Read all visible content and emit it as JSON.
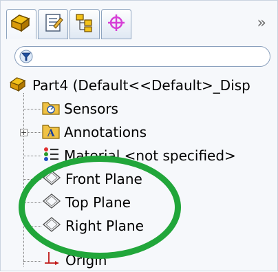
{
  "tabs": [
    {
      "name": "feature-manager",
      "icon": "part-icon"
    },
    {
      "name": "property-manager",
      "icon": "property-icon"
    },
    {
      "name": "configuration-manager",
      "icon": "configuration-icon"
    },
    {
      "name": "dimxpert-manager",
      "icon": "crosshair-icon"
    }
  ],
  "tab_overflow_label": "»",
  "filter": {
    "icon": "filter-icon",
    "value": ""
  },
  "tree": {
    "root_label": "Part4  (Default<<Default>_Disp",
    "items": [
      {
        "label": "Sensors",
        "icon": "sensors-folder-icon"
      },
      {
        "label": "Annotations",
        "icon": "annotations-icon"
      },
      {
        "label": "Material <not specified>",
        "icon": "material-icon"
      },
      {
        "label": "Front Plane",
        "icon": "plane-icon"
      },
      {
        "label": "Top Plane",
        "icon": "plane-icon"
      },
      {
        "label": "Right Plane",
        "icon": "plane-icon"
      },
      {
        "label": "Origin",
        "icon": "origin-icon"
      }
    ]
  },
  "colors": {
    "highlight_circle": "#21a63a",
    "accent": "#d63fd6"
  }
}
